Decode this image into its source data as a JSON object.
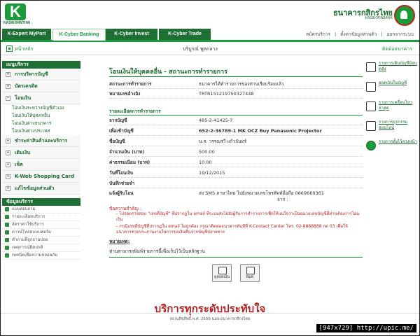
{
  "header": {
    "logo_letter": "K",
    "logo_sub": "KASIKORNTHAI",
    "bank_name_th": "ธนาคารกสิกรไทย",
    "bank_name_en": "KASIKORNBANK"
  },
  "tabs": [
    {
      "label": "K-Expert MyPort"
    },
    {
      "label": "K-Cyber Banking"
    },
    {
      "label": "K-Cyber Invest"
    },
    {
      "label": "K-Cyber Trade"
    }
  ],
  "top_links": {
    "apply": "สมัครบริการ",
    "settings": "ตั้งค่าข้อมูลส่วนตัว",
    "logout": "ออกจากระบบ"
  },
  "subbar": {
    "home": "หน้าหลัก",
    "user": "บริบูรณ์ พูลกลาง",
    "contact": "ติดต่อธนาคาร"
  },
  "sidebar": {
    "menu_title": "เมนูบริการ",
    "items": [
      {
        "label": "การบริหารบัญชี"
      },
      {
        "label": "บัตรเครดิต"
      },
      {
        "label": "โอนเงิน"
      }
    ],
    "transfer_subs": [
      {
        "label": "โอนเงินระหว่างบัญชีตัวเอง"
      },
      {
        "label": "โอนเงินให้บุคคลอื่น"
      },
      {
        "label": "โอนเงินต่างธนาคาร"
      },
      {
        "label": "โอนเงินต่างประเทศ"
      }
    ],
    "items2": [
      {
        "label": "ชำระค่าสินค้าและบริการ"
      },
      {
        "label": "เติมเงิน"
      },
      {
        "label": "เช็ค"
      },
      {
        "label": "K-Web Shopping Card"
      },
      {
        "label": "แก้ไขข้อมูลส่วนตัว"
      }
    ],
    "help_title": "ข้อมูลบริการ",
    "help_items": [
      {
        "label": "แบบสอบถาม"
      },
      {
        "label": "รายละเอียดบริการ"
      },
      {
        "label": "อัตราค่าใช้บริการ"
      },
      {
        "label": "ดาวน์โหลดแบบฟอร์ม"
      },
      {
        "label": "คำถามที่ถูกถามบ่อย"
      },
      {
        "label": "เหตุการณ์ผิดปกติ"
      },
      {
        "label": "เทคนิคเพื่อความปลอดภัย"
      }
    ]
  },
  "main": {
    "title": "โอนเงินให้บุคคลอื่น - สถานะการทำรายการ",
    "status_label": "สถานะการทำรายการ",
    "status_value": "ธนาคารได้ทำรายการของท่านเรียบร้อยแล้ว",
    "ref_label": "หมายเลขอ้างอิง",
    "ref_value": "TRTR151219750327448",
    "section_title": "รายละเอียดการทำรายการ",
    "rows": [
      {
        "k": "จากบัญชี",
        "v": "485-2-41425-7"
      },
      {
        "k": "เพื่อเข้าบัญชี",
        "v": "652-2-36789-1 MK OCZ Buy Panasonic Projector"
      },
      {
        "k": "ชื่อบัญชี",
        "v": "น.ส. วรรณรวี แก้วจันทร์"
      },
      {
        "k": "จำนวนเงิน (บาท)",
        "v": "500.00"
      },
      {
        "k": "ค่าธรรมเนียม (บาท)",
        "v": "10.00"
      },
      {
        "k": "วันที่โอนเงิน",
        "v": "19/12/2015"
      },
      {
        "k": "บันทึกช่วยจำ",
        "v": ""
      }
    ],
    "notify_label": "แจ้งผู้รับโอน",
    "notify_value_1": "ส่ง SMS ภาษาไทย ไปยังหมายเลขโทรศัพท์มือถือ 0869660361",
    "notify_value_2": "จาก :",
    "note_title": "ข้อความสำคัญ :",
    "note_1": "- โปรดตรวจสอบ \"เลขที่บัญชี\" ที่ปรากฏใน email ที่ระบบส่งไปยังผู้รับการทำรายการเพื่อให้แน่ใจว่าเป็นหมายเลขบัญชีที่ท่านต้องการโอนเงิน",
    "note_2": "- กรณีเลขที่บัญชีที่ปรากฏใน email ไม่ถูกต้อง กรุณาติดต่อธนาคารทันทีที่ K-Contact Center โทร. 02-8888888 กด 03 เพื่อให้ธนาคารช่วยประสานงานในการขอเงินคืนจากบัญชีปลายทาง",
    "remark_title": "หมายเหตุ:",
    "remark": "ท่านสามารถพิมพ์รายการนี้เพื่อเก็บไว้เป็นหลักฐาน",
    "btn_view": "ดูยอดเงิน",
    "btn_print": "พิมพ์"
  },
  "rail": [
    {
      "label": "รายการเดินบัญชีย้อนหลัง",
      "icon": "statement-icon"
    },
    {
      "label": "ยอดเงินในบัญชี",
      "icon": "balance-icon"
    },
    {
      "label": "รายการเคลื่อนไหวล่าสุด",
      "icon": "recent-icon"
    },
    {
      "label": "รายการธุรกรรมออนไลน์",
      "icon": "online-icon"
    },
    {
      "label": "รายการตั้งไว้ล่วงหน้า",
      "icon": "schedule-icon"
    }
  ],
  "footer": {
    "slogan": "บริการทุกระดับประทับใจ",
    "copyright": "สงวนลิขสิทธิ์ พ.ศ. 2556 บมจ.ธนาคารกสิกรไทย"
  },
  "watermark": "[947x729] http://upic.me/",
  "colors": {
    "brand_green": "#1a9b3a",
    "dark_green": "#1f6e33",
    "alert_red": "#c02020"
  }
}
